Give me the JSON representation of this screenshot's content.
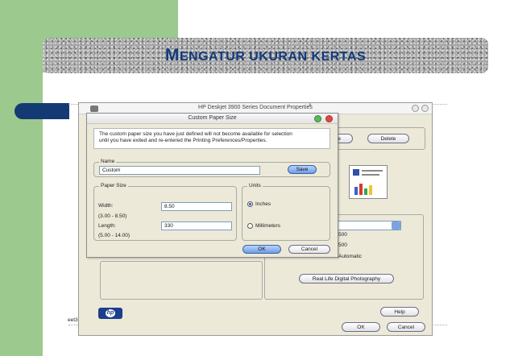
{
  "slide": {
    "title_initial": "M",
    "title_rest": "ENGATUR UKURAN KERTAS"
  },
  "background_window": {
    "title": "HP Deskjet 3900 Series Document Properties",
    "ruler_mark": "1",
    "delete_label": "Delete",
    "partial_delete_left": "e",
    "partial_values": [
      "500",
      "500",
      "Automatic"
    ],
    "real_life_label": "Real Life Digital Photography",
    "help_label": "Help",
    "ok_label": "OK",
    "cancel_label": "Cancel",
    "sheet_label": "eet3"
  },
  "dialog": {
    "title": "Custom Paper Size",
    "notice_line1": "The custom paper size you have just defined will not become available for selection",
    "notice_line2": "until you have exited and re-entered the Printing Preferences/Properties.",
    "name_legend": "Name",
    "name_value": "Custom",
    "save_label": "Save",
    "paper_size_legend": "Paper Size",
    "width_label": "Width:",
    "width_value": "8.50",
    "width_range": "(3.00 - 8.50)",
    "length_label": "Length:",
    "length_value": "330",
    "length_range": "(5.00 - 14.00)",
    "units_legend": "Units",
    "unit_inches": "Inches",
    "unit_mm": "Millimeters",
    "selected_unit": "Inches",
    "ok_label": "OK",
    "cancel_label": "Cancel"
  },
  "colors": {
    "green": "#9cc98d",
    "navy": "#133a73",
    "title_blue": "#123a7a"
  },
  "icons": [
    "printer-icon",
    "minimize-icon",
    "close-icon",
    "hp-logo-icon",
    "dropdown-arrow-icon"
  ]
}
